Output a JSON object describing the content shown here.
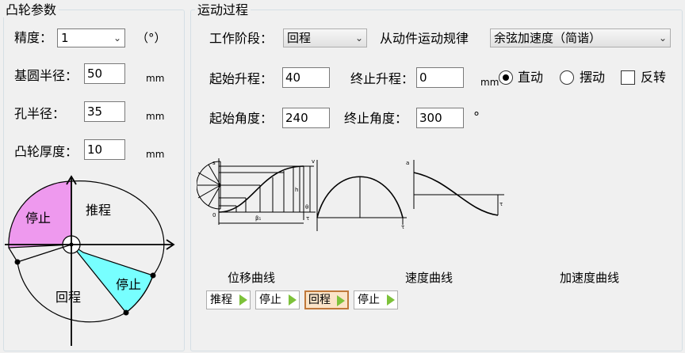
{
  "left_panel": {
    "title": "凸轮参数",
    "precision": {
      "label": "精度：",
      "value": "1",
      "unit": "（°）"
    },
    "base_radius": {
      "label": "基圆半径：",
      "value": "50",
      "unit": "mm"
    },
    "hole_radius": {
      "label": "孔半径：",
      "value": "35",
      "unit": "mm"
    },
    "thickness": {
      "label": "凸轮厚度：",
      "value": "10",
      "unit": "mm"
    },
    "cam_diagram": {
      "sector_push": "推程",
      "sector_stop1": "停止",
      "sector_return": "回程",
      "sector_stop2": "停止",
      "color_stop1": "#ee99ee",
      "color_stop2": "#77ffff"
    }
  },
  "right_panel": {
    "title": "运动过程",
    "stage": {
      "label": "工作阶段：",
      "value": "回程"
    },
    "law": {
      "label": "从动件运动规律",
      "value": "余弦加速度（简谐）"
    },
    "start_lift": {
      "label": "起始升程：",
      "value": "40"
    },
    "end_lift": {
      "label": "终止升程：",
      "value": "0",
      "unit": "mm"
    },
    "mode": {
      "translate": "直动",
      "swing": "摆动",
      "reverse": "反转",
      "selected": "直动",
      "reverse_checked": false
    },
    "start_angle": {
      "label": "起始角度：",
      "value": "240"
    },
    "end_angle": {
      "label": "终止角度：",
      "value": "300",
      "unit": "°"
    },
    "curve_captions": {
      "displacement": "位移曲线",
      "velocity": "速度曲线",
      "acceleration": "加速度曲线"
    },
    "diagram_labels": {
      "s": "s",
      "v": "v",
      "a": "a",
      "h": "h",
      "o": "0",
      "beta": "β₁",
      "theta": "θ",
      "tau": "τ"
    },
    "steps": [
      {
        "label": "推程",
        "active": false
      },
      {
        "label": "停止",
        "active": false
      },
      {
        "label": "回程",
        "active": true
      },
      {
        "label": "停止",
        "active": false
      }
    ],
    "active_color": "#fbe4c8"
  }
}
